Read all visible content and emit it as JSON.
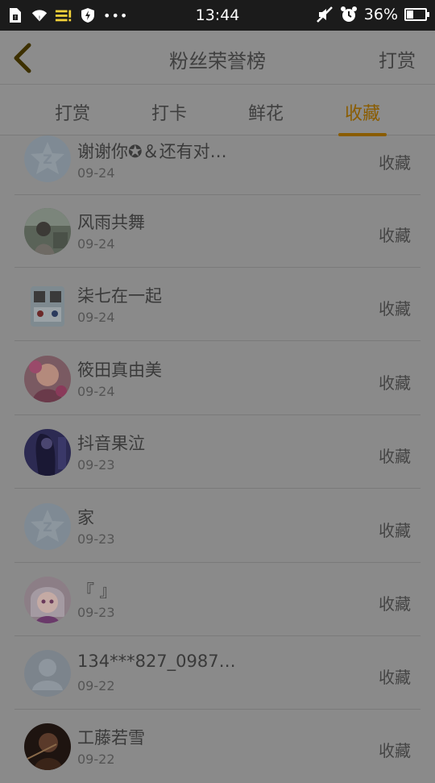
{
  "status_bar": {
    "time": "13:44",
    "battery_percent": "36%",
    "battery_level": 0.36,
    "left_icons": [
      "sim-icon",
      "wifi-icon",
      "signal-alert-icon",
      "shield-charge-icon",
      "more-dots-icon"
    ],
    "right_icons": [
      "silent-icon",
      "alarm-icon",
      "battery-icon"
    ]
  },
  "header": {
    "title": "粉丝荣誉榜",
    "action": "打赏"
  },
  "tabs": [
    {
      "label": "打赏",
      "active": false
    },
    {
      "label": "打卡",
      "active": false
    },
    {
      "label": "鲜花",
      "active": false
    },
    {
      "label": "收藏",
      "active": true
    }
  ],
  "list": {
    "action_label": "收藏",
    "items": [
      {
        "name": "谢谢你✪＆还有对…",
        "date": "09-24",
        "avatar": "default-star-avatar"
      },
      {
        "name": "风雨共舞",
        "date": "09-24",
        "avatar": "photo-avatar"
      },
      {
        "name": "柒七在一起",
        "date": "09-24",
        "avatar": "photo-avatar"
      },
      {
        "name": "筱田真由美",
        "date": "09-24",
        "avatar": "photo-avatar"
      },
      {
        "name": "抖音果泣",
        "date": "09-23",
        "avatar": "photo-avatar"
      },
      {
        "name": "家",
        "date": "09-23",
        "avatar": "default-star-avatar"
      },
      {
        "name": "『 』",
        "date": "09-23",
        "avatar": "photo-avatar"
      },
      {
        "name": "134***827_0987…",
        "date": "09-22",
        "avatar": "default-person-avatar"
      },
      {
        "name": "工藤若雪",
        "date": "09-22",
        "avatar": "photo-avatar"
      }
    ]
  },
  "colors": {
    "accent": "#8a5c00",
    "overlay_background": "#8a8a8a",
    "status_bar": "#1b1b1b"
  }
}
